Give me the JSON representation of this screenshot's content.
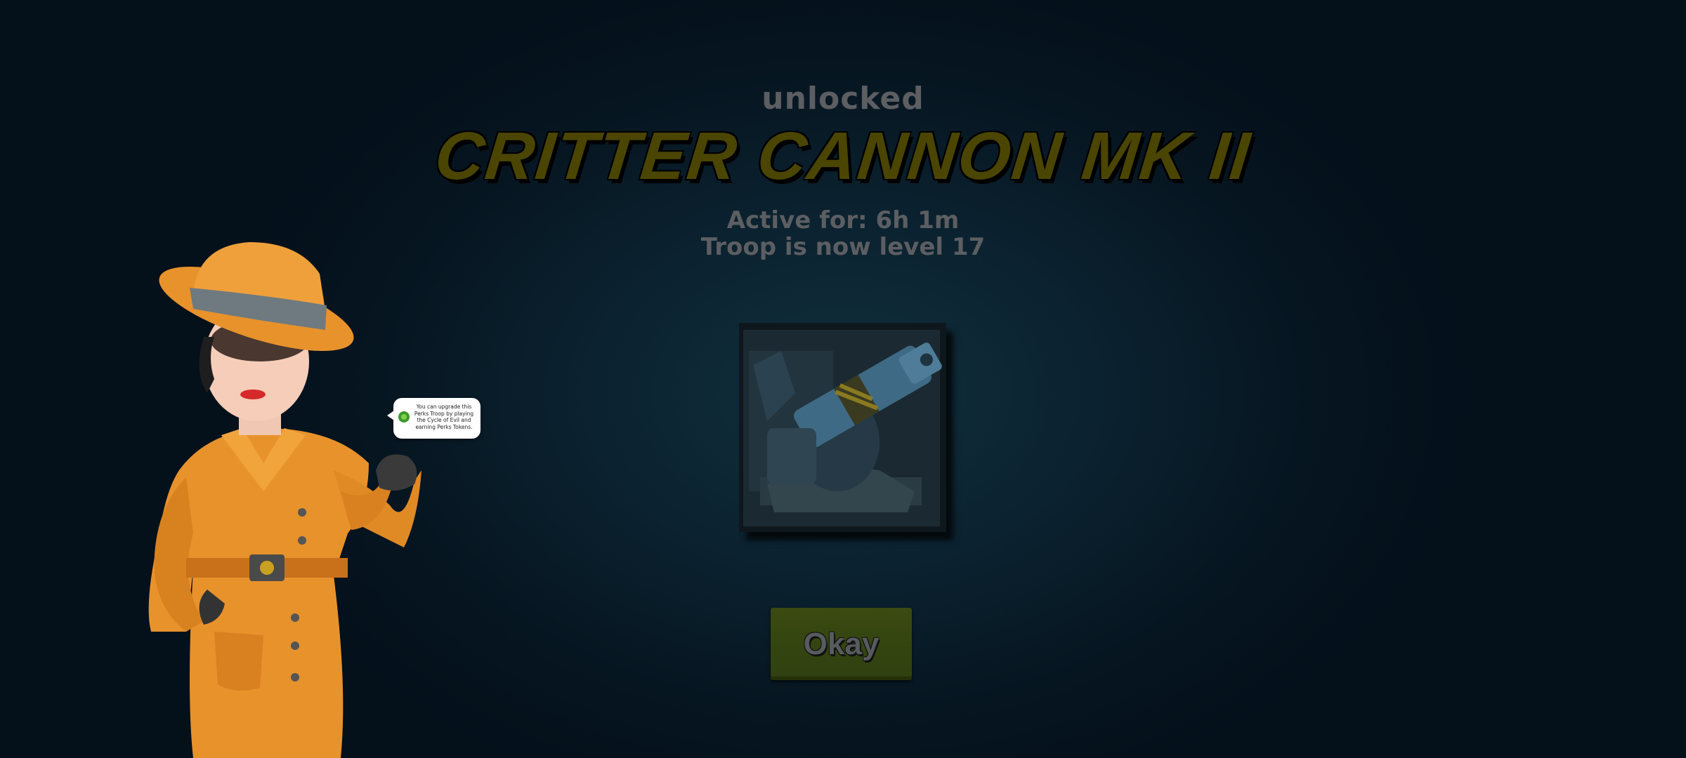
{
  "reward": {
    "status": "unlocked",
    "title": "CRITTER CANNON MK II",
    "active_for": "Active for: 6h 1m",
    "level_text": "Troop is now level 17"
  },
  "troop_image": {
    "icon": "critter-cannon-icon"
  },
  "okay_button": {
    "label": "Okay"
  },
  "tip": {
    "icon": "perks-token-icon",
    "text": "You can upgrade this Perks Troop by playing the Cycle of Evil and earning Perks Tokens."
  },
  "character": {
    "icon": "detective-character"
  },
  "colors": {
    "background": "#061520",
    "title": "#4a4500",
    "subtitle": "#5c5e62",
    "button": "#3a4a10",
    "coat": "#e8922c"
  }
}
